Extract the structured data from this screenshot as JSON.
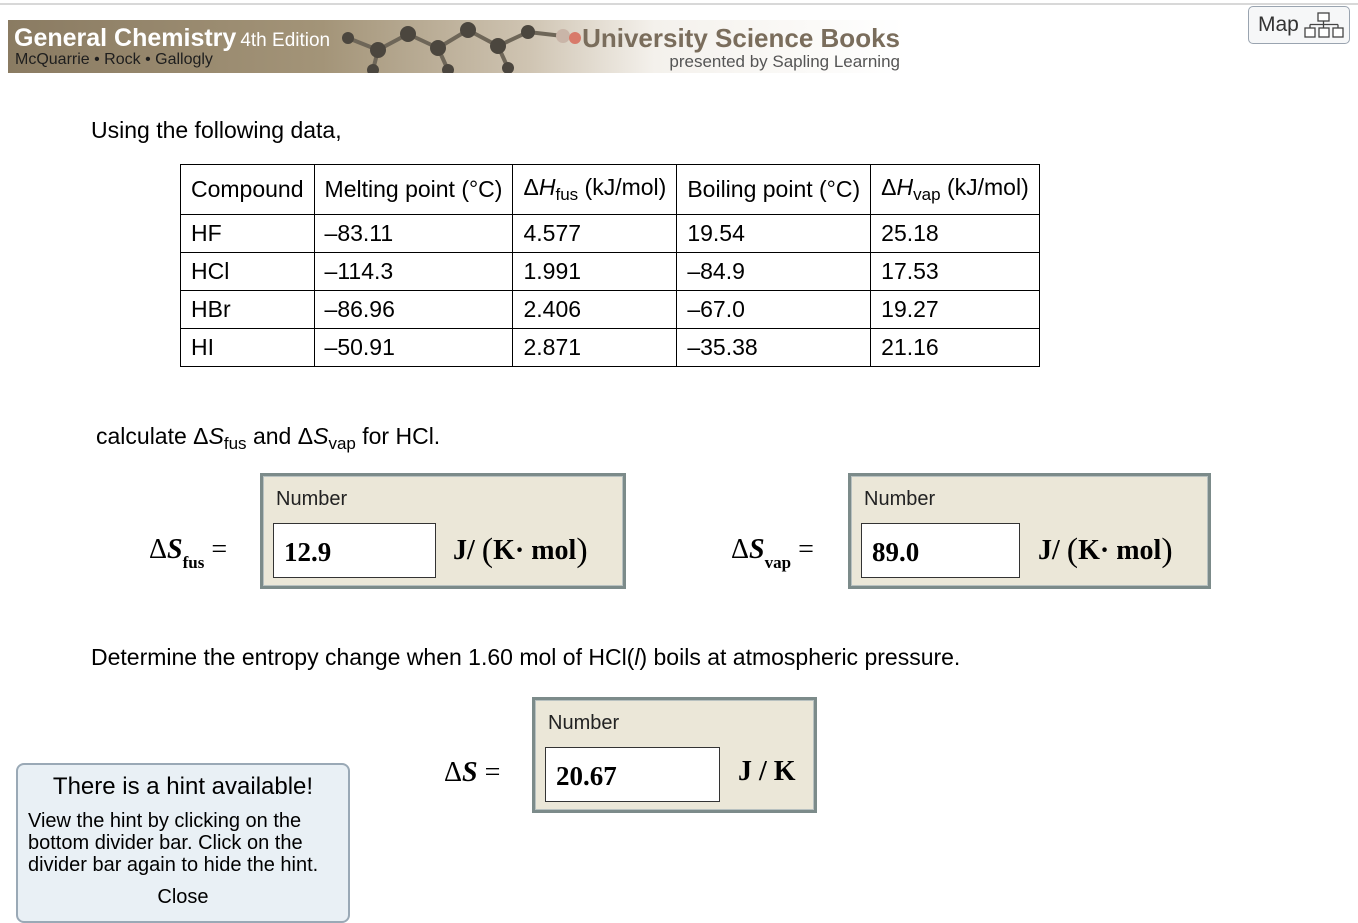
{
  "banner": {
    "title": "General Chemistry",
    "edition": "4th Edition",
    "authors": "McQuarrie • Rock • Gallogly",
    "publisher": "University Science Books",
    "presented_by": "presented by Sapling Learning"
  },
  "map_button": {
    "label": "Map"
  },
  "question": {
    "intro": "Using the following data,",
    "table": {
      "headers": [
        "Compound",
        "Melting point (°C)",
        "ΔHfus (kJ/mol)",
        "Boiling point (°C)",
        "ΔHvap (kJ/mol)"
      ],
      "rows": [
        [
          "HF",
          "–83.11",
          "4.577",
          "19.54",
          "25.18"
        ],
        [
          "HCl",
          "–114.3",
          "1.991",
          "–84.9",
          "17.53"
        ],
        [
          "HBr",
          "–86.96",
          "2.406",
          "–67.0",
          "19.27"
        ],
        [
          "HI",
          "–50.91",
          "2.871",
          "–35.38",
          "21.16"
        ]
      ]
    },
    "prompt1": "calculate ΔSfus and ΔSvap for HCl.",
    "prompt2": "Determine the entropy change when 1.60 mol of HCl(l) boils at atmospheric pressure."
  },
  "answers": {
    "fus": {
      "label": "ΔSfus =",
      "header": "Number",
      "value": "12.9",
      "unit": "J/ (K· mol)"
    },
    "vap": {
      "label": "ΔSvap =",
      "header": "Number",
      "value": "89.0",
      "unit": "J/ (K· mol)"
    },
    "total": {
      "label": "ΔS =",
      "header": "Number",
      "value": "20.67",
      "unit": "J / K"
    }
  },
  "hint": {
    "title": "There is a hint available!",
    "body": "View the hint by clicking on the bottom divider bar. Click on the divider bar again to hide the hint.",
    "close": "Close"
  }
}
